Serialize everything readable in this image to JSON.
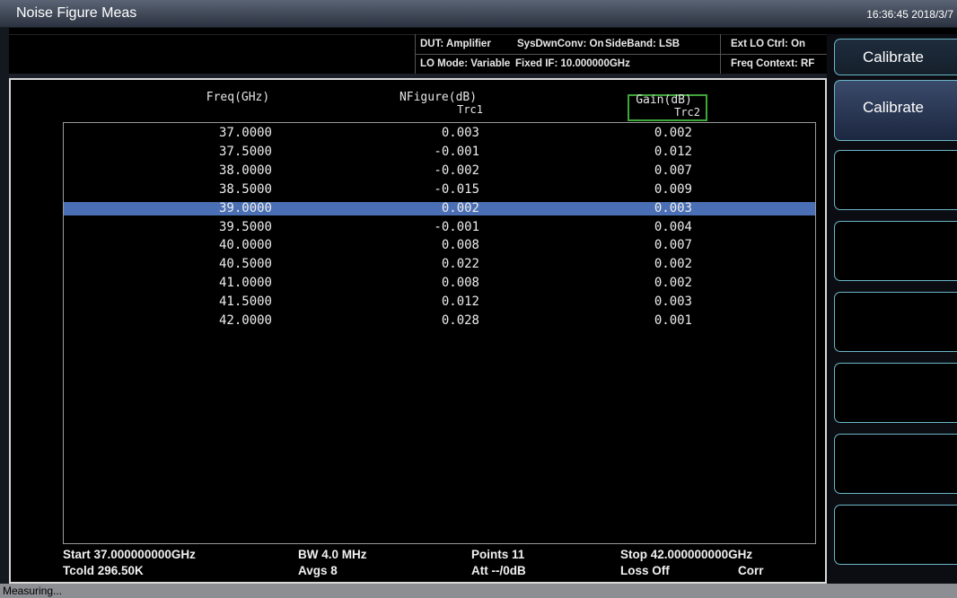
{
  "window": {
    "title": "Noise Figure Meas",
    "clock": "16:36:45  2018/3/7"
  },
  "info": {
    "dut": "DUT: Amplifier",
    "sysdwnconv": "SysDwnConv: On",
    "sideband": "SideBand: LSB",
    "ext_lo": "Ext LO Ctrl: On",
    "lo_mode": "LO Mode: Variable",
    "fixed_if": "Fixed IF: 10.000000GHz",
    "freq_context": "Freq Context: RF"
  },
  "table": {
    "headers": {
      "freq": "Freq(GHz)",
      "nfigure": "NFigure(dB)",
      "nfigure_trace": "Trc1",
      "gain": "Gain(dB)",
      "gain_trace": "Trc2"
    },
    "rows": [
      {
        "freq": "37.0000",
        "nf": "0.003",
        "gain": "0.002"
      },
      {
        "freq": "37.5000",
        "nf": "-0.001",
        "gain": "0.012"
      },
      {
        "freq": "38.0000",
        "nf": "-0.002",
        "gain": "0.007"
      },
      {
        "freq": "38.5000",
        "nf": "-0.015",
        "gain": "0.009"
      },
      {
        "freq": "39.0000",
        "nf": "0.002",
        "gain": "0.003"
      },
      {
        "freq": "39.5000",
        "nf": "-0.001",
        "gain": "0.004"
      },
      {
        "freq": "40.0000",
        "nf": "0.008",
        "gain": "0.007"
      },
      {
        "freq": "40.5000",
        "nf": "0.022",
        "gain": "0.002"
      },
      {
        "freq": "41.0000",
        "nf": "0.008",
        "gain": "0.002"
      },
      {
        "freq": "41.5000",
        "nf": "0.012",
        "gain": "0.003"
      },
      {
        "freq": "42.0000",
        "nf": "0.028",
        "gain": "0.001"
      }
    ],
    "selected_index": 4
  },
  "footer": {
    "start": "Start  37.000000000GHz",
    "bw": "BW  4.0  MHz",
    "points": "Points  11",
    "stop": "Stop  42.000000000GHz",
    "tcold": "Tcold 296.50K",
    "avgs": "Avgs  8",
    "att": "Att  --/0dB",
    "loss": "Loss  Off",
    "corr": "Corr"
  },
  "softkeys": {
    "title": "Calibrate",
    "keys": [
      "Calibrate",
      "",
      "",
      "",
      "",
      "",
      ""
    ]
  },
  "status": {
    "text": "Measuring..."
  },
  "colors": {
    "selected_row": "#4a6fb4",
    "gain_box": "#3fa63a",
    "softkey_border": "#6bb7c7"
  }
}
